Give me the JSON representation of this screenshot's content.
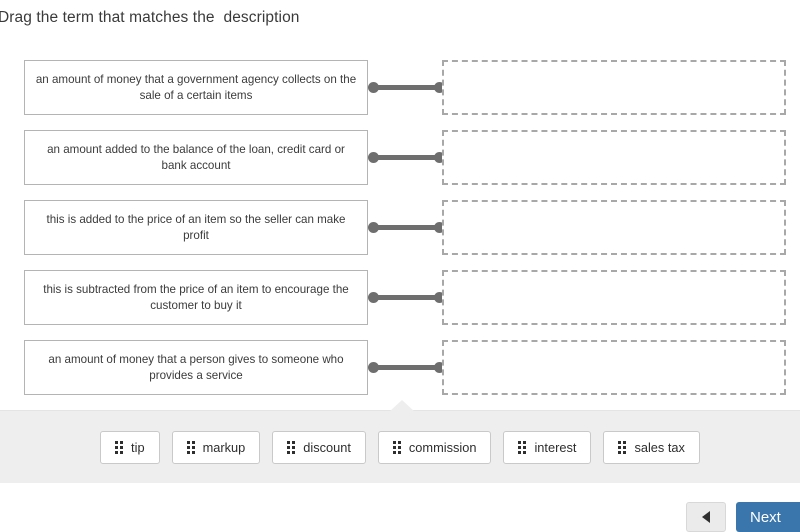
{
  "title": "Drag the term that matches the  description",
  "match_rows": [
    {
      "description": "an amount of money that a government agency collects on the sale of a certain items",
      "drop_value": ""
    },
    {
      "description": "an amount added to the balance of the loan, credit card or bank account",
      "drop_value": ""
    },
    {
      "description": "this is added to the price of an item so the seller can make profit",
      "drop_value": ""
    },
    {
      "description": "this is subtracted from the price of an item to encourage the customer to buy it",
      "drop_value": ""
    },
    {
      "description": "an amount of money that a person gives to someone who provides a service",
      "drop_value": ""
    }
  ],
  "term_tray": {
    "chips": [
      {
        "label": "tip",
        "handle_icon": "drag-handle-icon"
      },
      {
        "label": "markup",
        "handle_icon": "drag-handle-icon"
      },
      {
        "label": "discount",
        "handle_icon": "drag-handle-icon"
      },
      {
        "label": "commission",
        "handle_icon": "drag-handle-icon"
      },
      {
        "label": "interest",
        "handle_icon": "drag-handle-icon"
      },
      {
        "label": "sales tax",
        "handle_icon": "drag-handle-icon"
      }
    ]
  },
  "footer": {
    "back_icon": "back-arrow-icon",
    "next_label": "Next"
  },
  "colors": {
    "next_button": "#3a76ac",
    "tray_background": "#eeeeee",
    "connector": "#6e6e6e",
    "dropzone_border": "#a8a8a8",
    "desc_border": "#b4b4b4"
  }
}
